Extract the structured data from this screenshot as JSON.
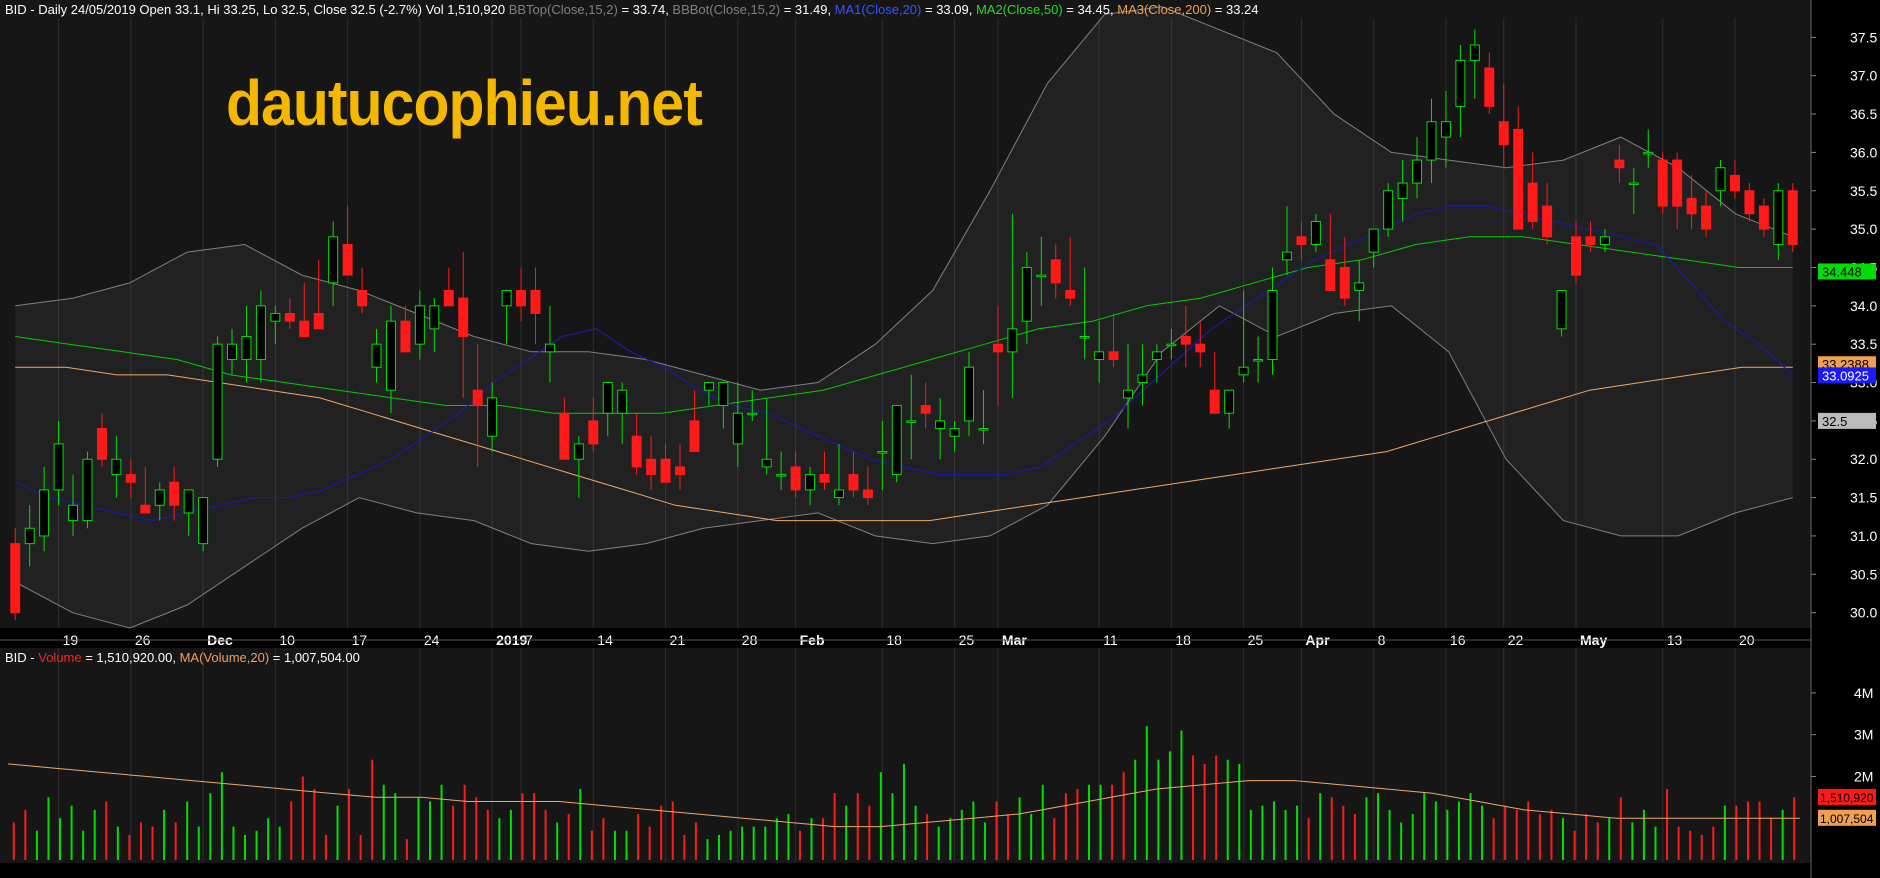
{
  "header": {
    "prefix": "BID - Daily 24/05/2019 Open 33.1, Hi 33.25, Lo 32.5, Close 32.5 (-2.7%) Vol 1,510,920 ",
    "bbtop_label": "BBTop(Close,15,2)",
    "bbtop_value": " = 33.74, ",
    "bbbot_label": "BBBot(Close,15,2)",
    "bbbot_value": " = 31.49, ",
    "ma1_label": "MA1(Close,20)",
    "ma1_value": " = 33.09, ",
    "ma2_label": "MA2(Close,50)",
    "ma2_value": " = 34.45, ",
    "ma3_label": "MA3(Close,200)",
    "ma3_value": " = 33.24"
  },
  "volume_header": {
    "prefix": "BID - ",
    "vol_label": "Volume",
    "vol_value": " = 1,510,920.00, ",
    "ma_label": "MA(Volume,20)",
    "ma_value": " = 1,007,504.00"
  },
  "watermark": "dautucophieu.net",
  "colors": {
    "background": "#000000",
    "panel": "#161616",
    "up": "#00e000",
    "down": "#ff1a1a",
    "ma1": "#1a1aa8",
    "ma2": "#00cc00",
    "ma3": "#f0a868",
    "bollinger": "#808080",
    "header_muted": "#808080",
    "ma1_label": "#3355ff",
    "ma2_label": "#22dd22",
    "ma3_label": "#f0a050",
    "vol_label": "#ff2020",
    "watermark": "#f5b800"
  },
  "chart_data": [
    {
      "type": "candlestick",
      "ylim": [
        29.8,
        37.7
      ],
      "y_ticks": [
        "30.0",
        "30.5",
        "31.0",
        "31.5",
        "32.0",
        "32.5",
        "33.0",
        "33.5",
        "34.0",
        "34.5",
        "35.0",
        "35.5",
        "36.0",
        "36.5",
        "37.0",
        "37.5"
      ],
      "x_labels": [
        {
          "bar": 3,
          "text": "19"
        },
        {
          "bar": 8,
          "text": "26"
        },
        {
          "bar": 13,
          "text": "Dec"
        },
        {
          "bar": 18,
          "text": "10"
        },
        {
          "bar": 23,
          "text": "17"
        },
        {
          "bar": 28,
          "text": "24"
        },
        {
          "bar": 33,
          "text": "2019"
        },
        {
          "bar": 35,
          "text": "7"
        },
        {
          "bar": 40,
          "text": "14"
        },
        {
          "bar": 45,
          "text": "21"
        },
        {
          "bar": 50,
          "text": "28"
        },
        {
          "bar": 54,
          "text": "Feb"
        },
        {
          "bar": 60,
          "text": "18"
        },
        {
          "bar": 65,
          "text": "25"
        },
        {
          "bar": 68,
          "text": "Mar"
        },
        {
          "bar": 75,
          "text": "11"
        },
        {
          "bar": 80,
          "text": "18"
        },
        {
          "bar": 85,
          "text": "25"
        },
        {
          "bar": 89,
          "text": "Apr"
        },
        {
          "bar": 94,
          "text": "8"
        },
        {
          "bar": 99,
          "text": "16"
        },
        {
          "bar": 103,
          "text": "22"
        },
        {
          "bar": 108,
          "text": "May"
        },
        {
          "bar": 114,
          "text": "13"
        },
        {
          "bar": 119,
          "text": "20"
        }
      ],
      "ohlc": [
        [
          30.9,
          31.1,
          29.9,
          30.0
        ],
        [
          30.9,
          31.4,
          30.6,
          31.1
        ],
        [
          31.0,
          31.9,
          30.8,
          31.6
        ],
        [
          31.6,
          32.5,
          31.4,
          32.2
        ],
        [
          31.2,
          31.8,
          31.0,
          31.4
        ],
        [
          31.2,
          32.1,
          31.1,
          32.0
        ],
        [
          32.4,
          32.6,
          31.9,
          32.0
        ],
        [
          31.8,
          32.3,
          31.5,
          32.0
        ],
        [
          31.8,
          32.0,
          31.5,
          31.7
        ],
        [
          31.4,
          31.9,
          31.3,
          31.3
        ],
        [
          31.4,
          31.7,
          31.2,
          31.6
        ],
        [
          31.7,
          31.9,
          31.2,
          31.4
        ],
        [
          31.3,
          31.6,
          31.0,
          31.6
        ],
        [
          30.9,
          31.4,
          30.8,
          31.5
        ],
        [
          32.0,
          33.6,
          31.9,
          33.5
        ],
        [
          33.3,
          33.7,
          33.1,
          33.5
        ],
        [
          33.3,
          34.0,
          33.0,
          33.6
        ],
        [
          33.3,
          34.2,
          33.0,
          34.0
        ],
        [
          33.8,
          34.0,
          33.5,
          33.9
        ],
        [
          33.9,
          34.1,
          33.7,
          33.8
        ],
        [
          33.8,
          34.3,
          33.7,
          33.6
        ],
        [
          33.9,
          34.6,
          33.7,
          33.7
        ],
        [
          34.3,
          35.1,
          34.0,
          34.9
        ],
        [
          34.8,
          35.3,
          34.5,
          34.4
        ],
        [
          34.2,
          34.5,
          33.9,
          34.0
        ],
        [
          33.2,
          33.7,
          33.0,
          33.5
        ],
        [
          32.9,
          34.0,
          32.6,
          33.8
        ],
        [
          33.8,
          34.0,
          33.4,
          33.4
        ],
        [
          33.5,
          34.2,
          33.3,
          34.0
        ],
        [
          33.7,
          34.1,
          33.4,
          34.0
        ],
        [
          34.2,
          34.5,
          34.0,
          34.0
        ],
        [
          34.1,
          34.7,
          32.8,
          33.6
        ],
        [
          32.9,
          33.5,
          31.9,
          32.7
        ],
        [
          32.3,
          33.0,
          32.1,
          32.8
        ],
        [
          34.0,
          34.2,
          33.5,
          34.2
        ],
        [
          34.2,
          34.5,
          33.8,
          34.0
        ],
        [
          34.2,
          34.5,
          33.5,
          33.9
        ],
        [
          33.4,
          34.0,
          33.0,
          33.5
        ],
        [
          32.6,
          32.8,
          32.1,
          32.0
        ],
        [
          32.0,
          32.3,
          31.5,
          32.2
        ],
        [
          32.5,
          32.8,
          32.1,
          32.2
        ],
        [
          32.6,
          33.0,
          32.3,
          33.0
        ],
        [
          32.6,
          33.0,
          32.2,
          32.9
        ],
        [
          32.3,
          32.6,
          31.8,
          31.9
        ],
        [
          32.0,
          32.3,
          31.6,
          31.8
        ],
        [
          32.0,
          32.2,
          31.7,
          31.7
        ],
        [
          31.9,
          32.2,
          31.6,
          31.8
        ],
        [
          32.5,
          32.9,
          32.2,
          32.1
        ],
        [
          32.9,
          33.0,
          32.7,
          33.0
        ],
        [
          32.7,
          33.0,
          32.4,
          33.0
        ],
        [
          32.2,
          33.0,
          31.9,
          32.6
        ],
        [
          32.6,
          32.9,
          32.5,
          32.6
        ],
        [
          31.9,
          32.8,
          31.8,
          32.0
        ],
        [
          31.8,
          32.1,
          31.6,
          31.8
        ],
        [
          31.9,
          32.1,
          31.5,
          31.6
        ],
        [
          31.6,
          31.9,
          31.4,
          31.8
        ],
        [
          31.8,
          32.1,
          31.6,
          31.7
        ],
        [
          31.5,
          32.2,
          31.4,
          31.6
        ],
        [
          31.8,
          32.1,
          31.5,
          31.6
        ],
        [
          31.6,
          31.9,
          31.4,
          31.5
        ],
        [
          32.1,
          32.5,
          31.6,
          32.1
        ],
        [
          31.8,
          32.7,
          31.7,
          32.7
        ],
        [
          32.5,
          33.1,
          32.0,
          32.5
        ],
        [
          32.7,
          33.0,
          32.4,
          32.6
        ],
        [
          32.4,
          32.8,
          32.0,
          32.5
        ],
        [
          32.3,
          32.5,
          32.1,
          32.4
        ],
        [
          32.5,
          33.4,
          32.3,
          33.2
        ],
        [
          32.4,
          32.9,
          32.2,
          32.4
        ],
        [
          33.5,
          34.0,
          32.7,
          33.4
        ],
        [
          33.4,
          35.2,
          32.8,
          33.7
        ],
        [
          33.8,
          34.7,
          33.5,
          34.5
        ],
        [
          34.4,
          34.9,
          34.0,
          34.4
        ],
        [
          34.6,
          34.8,
          34.1,
          34.3
        ],
        [
          34.2,
          34.9,
          34.0,
          34.1
        ],
        [
          33.6,
          34.5,
          33.3,
          33.6
        ],
        [
          33.3,
          33.8,
          33.0,
          33.4
        ],
        [
          33.4,
          33.9,
          33.2,
          33.3
        ],
        [
          32.8,
          33.5,
          32.4,
          32.9
        ],
        [
          33.0,
          33.5,
          32.7,
          33.1
        ],
        [
          33.3,
          33.5,
          33.0,
          33.4
        ],
        [
          33.5,
          33.7,
          33.3,
          33.5
        ],
        [
          33.6,
          34.0,
          33.2,
          33.5
        ],
        [
          33.5,
          33.8,
          33.2,
          33.4
        ],
        [
          32.9,
          33.4,
          32.7,
          32.6
        ],
        [
          32.6,
          32.9,
          32.4,
          32.9
        ],
        [
          33.1,
          34.2,
          33.0,
          33.2
        ],
        [
          33.3,
          33.6,
          33.0,
          33.3
        ],
        [
          33.3,
          34.5,
          33.1,
          34.2
        ],
        [
          34.6,
          35.3,
          34.4,
          34.7
        ],
        [
          34.9,
          35.1,
          34.6,
          34.8
        ],
        [
          34.8,
          35.2,
          34.7,
          35.1
        ],
        [
          34.6,
          35.2,
          34.3,
          34.2
        ],
        [
          34.5,
          34.9,
          34.0,
          34.1
        ],
        [
          34.2,
          34.6,
          33.8,
          34.3
        ],
        [
          34.7,
          35.0,
          34.5,
          35.0
        ],
        [
          35.0,
          35.6,
          34.9,
          35.5
        ],
        [
          35.4,
          35.9,
          35.1,
          35.6
        ],
        [
          35.6,
          36.2,
          35.4,
          35.9
        ],
        [
          35.9,
          36.7,
          35.6,
          36.4
        ],
        [
          36.2,
          36.8,
          35.8,
          36.4
        ],
        [
          36.6,
          37.4,
          36.2,
          37.2
        ],
        [
          37.2,
          37.6,
          36.7,
          37.4
        ],
        [
          37.1,
          37.3,
          36.5,
          36.6
        ],
        [
          36.4,
          36.9,
          35.8,
          36.1
        ],
        [
          36.3,
          36.6,
          35.3,
          35.0
        ],
        [
          35.6,
          36.0,
          35.0,
          35.1
        ],
        [
          35.3,
          35.6,
          34.8,
          34.9
        ],
        [
          33.7,
          34.2,
          33.6,
          34.2
        ],
        [
          34.9,
          35.1,
          34.3,
          34.4
        ],
        [
          34.9,
          35.1,
          34.7,
          34.8
        ],
        [
          34.8,
          35.0,
          34.7,
          34.9
        ],
        [
          35.9,
          36.1,
          35.6,
          35.8
        ],
        [
          35.6,
          35.8,
          35.2,
          35.6
        ],
        [
          36.0,
          36.3,
          35.8,
          36.0
        ],
        [
          35.9,
          36.0,
          35.2,
          35.3
        ],
        [
          35.9,
          36.0,
          35.0,
          35.3
        ],
        [
          35.4,
          35.7,
          35.0,
          35.2
        ],
        [
          35.3,
          35.5,
          34.9,
          35.0
        ],
        [
          35.5,
          35.9,
          35.3,
          35.8
        ],
        [
          35.7,
          35.9,
          35.4,
          35.5
        ],
        [
          35.5,
          35.6,
          35.1,
          35.2
        ],
        [
          35.3,
          35.4,
          34.9,
          35.0
        ],
        [
          34.8,
          35.6,
          34.6,
          35.5
        ],
        [
          35.5,
          35.6,
          34.7,
          34.8
        ]
      ],
      "ma1": [
        31.7,
        31.5,
        31.4,
        31.3,
        31.2,
        31.3,
        31.4,
        31.5,
        31.5,
        31.6,
        31.8,
        32.0,
        32.3,
        32.6,
        33.0,
        33.3,
        33.6,
        33.7,
        33.4,
        33.2,
        32.9,
        32.7,
        32.6,
        32.4,
        32.2,
        32.0,
        31.9,
        31.8,
        31.8,
        31.8,
        31.9,
        32.2,
        32.5,
        32.9,
        33.3,
        33.7,
        34.0,
        34.3,
        34.6,
        34.8,
        35.0,
        35.2,
        35.3,
        35.3,
        35.2,
        35.1,
        35.0,
        34.9,
        34.8,
        34.3,
        33.8,
        33.5,
        33.1
      ],
      "ma2": [
        33.6,
        33.5,
        33.4,
        33.3,
        33.1,
        33.0,
        32.9,
        32.8,
        32.7,
        32.7,
        32.6,
        32.6,
        32.6,
        32.7,
        32.8,
        32.9,
        33.1,
        33.3,
        33.5,
        33.7,
        33.8,
        34.0,
        34.1,
        34.3,
        34.5,
        34.6,
        34.8,
        34.9,
        34.9,
        34.8,
        34.7,
        34.6,
        34.5,
        34.5
      ],
      "ma3": [
        33.2,
        33.2,
        33.1,
        33.1,
        33.0,
        32.9,
        32.8,
        32.6,
        32.4,
        32.2,
        32.0,
        31.8,
        31.6,
        31.4,
        31.3,
        31.2,
        31.2,
        31.2,
        31.2,
        31.3,
        31.4,
        31.5,
        31.6,
        31.7,
        31.8,
        31.9,
        32.0,
        32.1,
        32.3,
        32.5,
        32.7,
        32.9,
        33.0,
        33.1,
        33.2,
        33.2
      ],
      "bb_upper": [
        34.0,
        34.1,
        34.3,
        34.7,
        34.8,
        34.4,
        34.2,
        33.9,
        33.6,
        33.4,
        33.4,
        33.3,
        33.1,
        32.9,
        33.0,
        33.5,
        34.2,
        35.5,
        36.9,
        37.8,
        37.9,
        37.6,
        37.3,
        36.5,
        36.0,
        35.9,
        35.8,
        35.9,
        36.2,
        35.8,
        35.2,
        34.9
      ],
      "bb_lower": [
        30.4,
        30.0,
        29.8,
        30.1,
        30.6,
        31.1,
        31.5,
        31.3,
        31.2,
        30.9,
        30.8,
        30.9,
        31.1,
        31.2,
        31.3,
        31.0,
        30.9,
        31.0,
        31.4,
        32.3,
        33.4,
        34.0,
        33.6,
        33.9,
        34.0,
        33.4,
        32.0,
        31.2,
        31.0,
        31.0,
        31.3,
        31.5
      ],
      "last_labels": {
        "ma2": "34.448",
        "ma3": "33.2388",
        "ma1": "33.0925",
        "close": "32.5"
      }
    },
    {
      "type": "bar",
      "title": "Volume",
      "y_ticks": [
        "4M",
        "3M",
        "2M"
      ],
      "ylim": [
        0,
        4.5
      ],
      "values": [
        0.9,
        1.2,
        0.7,
        1.5,
        1.0,
        1.3,
        0.7,
        1.2,
        1.4,
        0.8,
        0.6,
        0.9,
        0.8,
        1.2,
        0.9,
        1.4,
        0.8,
        1.6,
        2.1,
        0.8,
        0.6,
        0.7,
        1.0,
        0.8,
        1.4,
        2.0,
        1.7,
        0.6,
        1.3,
        1.7,
        0.6,
        2.4,
        1.8,
        1.6,
        0.5,
        1.5,
        1.4,
        1.8,
        1.3,
        1.8,
        1.5,
        1.2,
        1.0,
        1.2,
        1.6,
        1.6,
        1.2,
        0.9,
        1.1,
        1.7,
        0.7,
        1.0,
        0.7,
        0.7,
        1.1,
        0.8,
        1.3,
        1.4,
        0.6,
        0.9,
        0.5,
        0.6,
        0.7,
        0.8,
        0.8,
        0.8,
        1.0,
        1.1,
        0.7,
        1.0,
        1.0,
        1.6,
        1.3,
        1.6,
        1.3,
        2.1,
        1.6,
        2.3,
        1.3,
        1.1,
        0.8,
        1.0,
        1.2,
        1.4,
        0.9,
        1.4,
        1.1,
        1.5,
        1.1,
        1.8,
        1.0,
        1.6,
        1.7,
        1.8,
        1.8,
        1.8,
        2.1,
        2.4,
        3.2,
        2.4,
        2.6,
        3.1,
        2.5,
        2.3,
        2.5,
        2.4,
        2.3,
        1.2,
        1.3,
        1.4,
        1.2,
        1.3,
        1.0,
        1.6,
        1.5,
        1.3,
        1.1,
        1.5,
        1.6,
        1.2,
        0.9,
        1.1,
        1.6,
        1.4,
        1.2,
        1.4,
        1.6,
        1.3,
        1.0,
        1.3,
        1.2,
        1.4,
        1.1,
        1.2,
        1.0,
        0.7,
        1.1,
        0.9,
        1.0,
        1.5,
        0.9,
        1.2,
        0.8,
        1.7,
        0.8,
        0.7,
        0.6,
        0.8,
        1.3,
        1.3,
        1.4,
        1.4,
        1.0,
        1.2,
        1.5
      ],
      "ma": [
        2.3,
        2.2,
        2.1,
        2.0,
        1.9,
        1.8,
        1.7,
        1.6,
        1.5,
        1.5,
        1.4,
        1.4,
        1.4,
        1.3,
        1.2,
        1.1,
        1.0,
        0.9,
        0.8,
        0.8,
        0.9,
        1.0,
        1.1,
        1.3,
        1.5,
        1.7,
        1.8,
        1.9,
        1.9,
        1.8,
        1.7,
        1.6,
        1.4,
        1.2,
        1.1,
        1.0,
        1.0,
        1.0,
        1.0,
        1.0
      ]
    }
  ]
}
